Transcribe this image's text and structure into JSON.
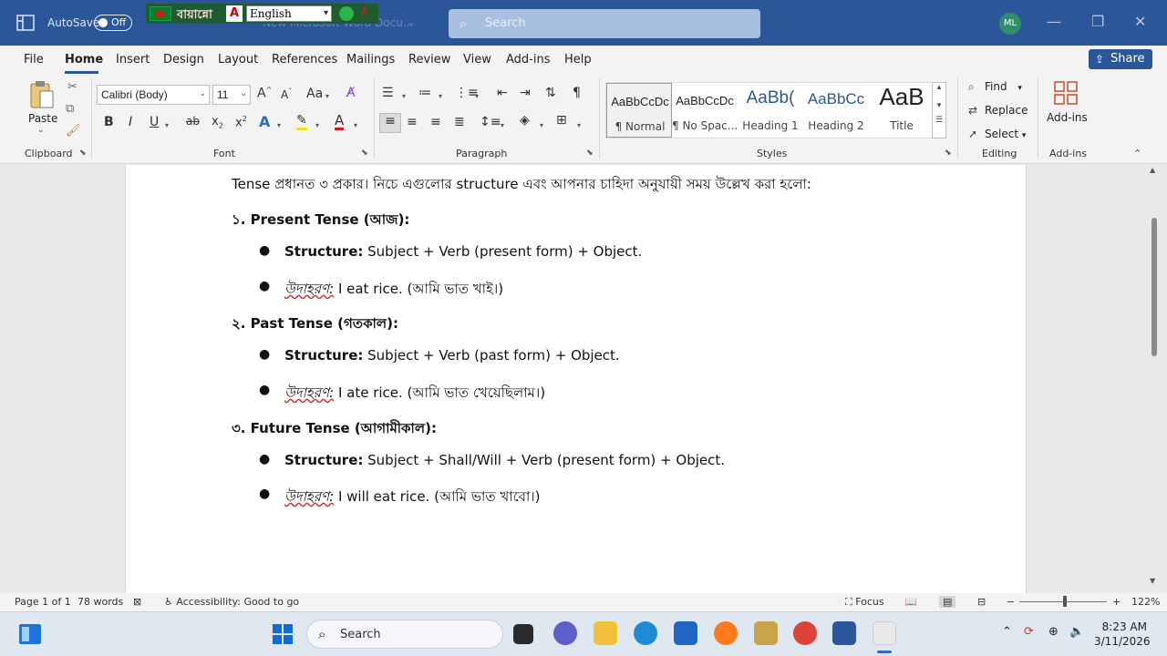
{
  "titlebar": {
    "autosave_label": "AutoSave",
    "autosave_state": "Off",
    "doc_title": "New Microsoft Word Docu...",
    "ime_language": "বায়ান্নো",
    "ime_selected": "English",
    "search_placeholder": "Search",
    "avatar_initials": "ML"
  },
  "tabs": [
    "File",
    "Home",
    "Insert",
    "Design",
    "Layout",
    "References",
    "Mailings",
    "Review",
    "View",
    "Add-ins",
    "Help"
  ],
  "share_label": "Share",
  "ribbon": {
    "clipboard": {
      "paste_label": "Paste",
      "group_label": "Clipboard"
    },
    "font": {
      "family": "Calibri (Body)",
      "size": "11",
      "group_label": "Font"
    },
    "paragraph": {
      "group_label": "Paragraph"
    },
    "styles": {
      "group_label": "Styles",
      "items": [
        {
          "sample": "AaBbCcDc",
          "name": "¶ Normal"
        },
        {
          "sample": "AaBbCcDc",
          "name": "¶ No Spac..."
        },
        {
          "sample": "AaBb(",
          "name": "Heading 1"
        },
        {
          "sample": "AaBbCc",
          "name": "Heading 2"
        },
        {
          "sample": "AaB",
          "name": "Title"
        }
      ]
    },
    "editing": {
      "find": "Find",
      "replace": "Replace",
      "select": "Select",
      "group_label": "Editing"
    },
    "addins": {
      "label": "Add-ins",
      "group_label": "Add-ins"
    }
  },
  "document": {
    "intro": "Tense প্রধানত ৩ প্রকার। নিচে এগুলোর structure এবং আপনার চাহিদা অনুযায়ী সময় উল্লেখ করা হলো:",
    "sections": [
      {
        "heading": "১. Present Tense (আজ):",
        "structure_label": "Structure:",
        "structure_text": " Subject + Verb (present form) + Object.",
        "example_label": "উদাহরণ:",
        "example_text": " I eat rice. (আমি ভাত খাই।)"
      },
      {
        "heading": "২. Past Tense (গতকাল):",
        "structure_label": "Structure:",
        "structure_text": " Subject + Verb (past form) + Object.",
        "example_label": "উদাহরণ:",
        "example_text": " I ate rice. (আমি ভাত খেয়েছিলাম।)"
      },
      {
        "heading": "৩. Future Tense (আগামীকাল):",
        "structure_label": "Structure:",
        "structure_text": " Subject + Shall/Will + Verb (present form) + Object.",
        "example_label": "উদাহরণ:",
        "example_text": " I will eat rice. (আমি ভাত খাবো।)"
      }
    ]
  },
  "statusbar": {
    "page": "Page 1 of 1",
    "words": "78 words",
    "accessibility": "Accessibility: Good to go",
    "focus": "Focus",
    "zoom": "122%",
    "zoom_level_percent": 122
  },
  "taskbar": {
    "search_label": "Search",
    "time": "8:23 AM",
    "date": "3/11/2026"
  },
  "colors": {
    "word_blue": "#2b579a",
    "ribbon_bg": "#f3f3f3",
    "taskbar_bg": "#dfe7f1"
  }
}
